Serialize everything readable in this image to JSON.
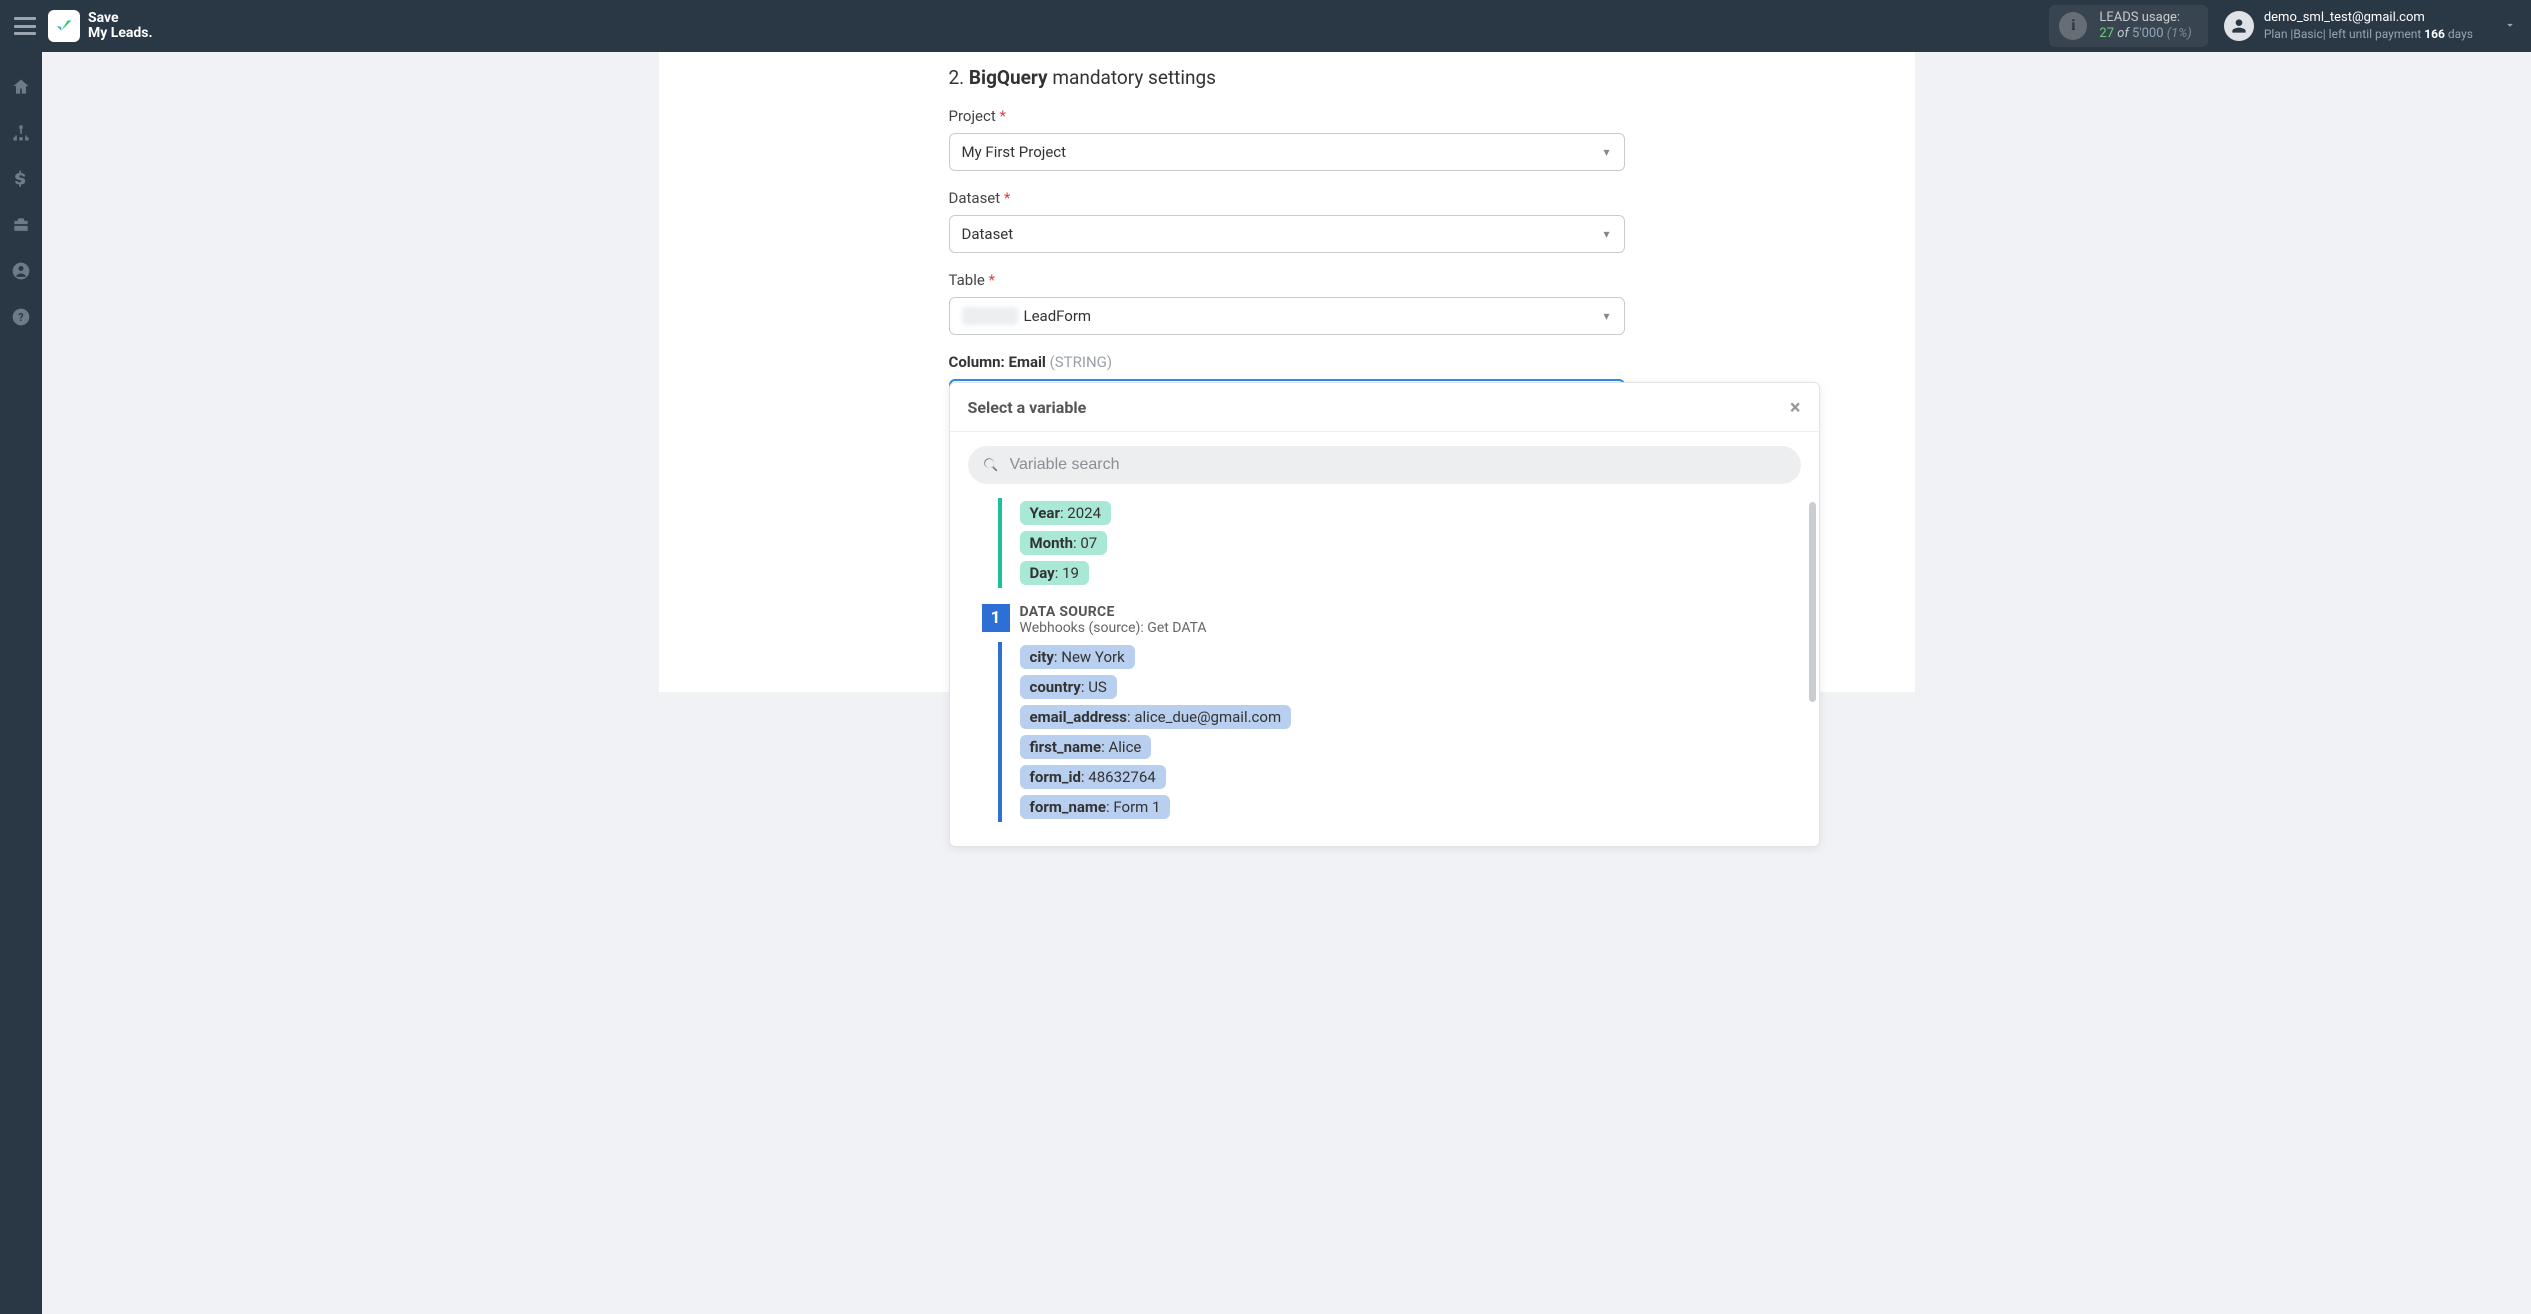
{
  "header": {
    "brand_line1": "Save",
    "brand_line2": "My Leads.",
    "usage": {
      "label": "LEADS usage:",
      "count": "27",
      "of_word": "of",
      "total": "5'000",
      "percent": "(1%)"
    },
    "account": {
      "email": "demo_sml_test@gmail.com",
      "plan_prefix": "Plan |Basic| left until payment ",
      "days": "166",
      "days_suffix": " days"
    }
  },
  "section": {
    "number": "2.",
    "strong": "BigQuery",
    "rest": "mandatory settings"
  },
  "fields": {
    "project": {
      "label": "Project",
      "value": "My First Project"
    },
    "dataset": {
      "label": "Dataset",
      "value": "Dataset"
    },
    "table": {
      "label": "Table",
      "value": "LeadForm"
    }
  },
  "column": {
    "label": "Column: Email",
    "type": "(STRING)",
    "chip_source": "Webhooks (source)",
    "chip_key": "email_address:",
    "chip_sample": "«alice_due@gmail.com»"
  },
  "dropdown": {
    "title": "Select a variable",
    "search_placeholder": "Variable search",
    "sys_vars": [
      {
        "k": "Year",
        "v": "2024"
      },
      {
        "k": "Month",
        "v": "07"
      },
      {
        "k": "Day",
        "v": "19"
      }
    ],
    "data_source": {
      "badge": "1",
      "title": "DATA SOURCE",
      "subtitle": "Webhooks (source): Get DATA",
      "vars": [
        {
          "k": "city",
          "v": "New York"
        },
        {
          "k": "country",
          "v": "US"
        },
        {
          "k": "email_address",
          "v": "alice_due@gmail.com"
        },
        {
          "k": "first_name",
          "v": "Alice"
        },
        {
          "k": "form_id",
          "v": "48632764"
        },
        {
          "k": "form_name",
          "v": "Form 1"
        }
      ]
    }
  }
}
